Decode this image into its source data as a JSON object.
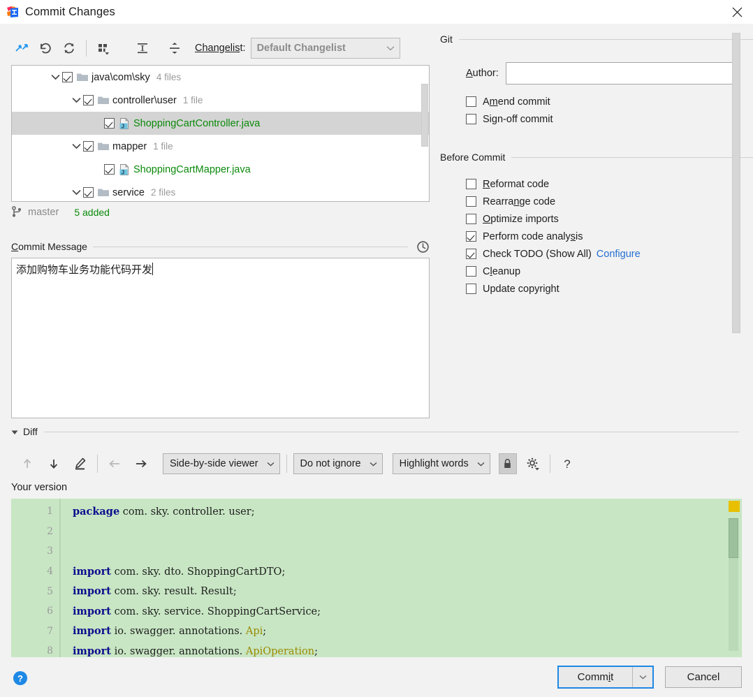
{
  "window": {
    "title": "Commit Changes",
    "app_icon": "intellij-idea-icon",
    "close_icon": "close-icon"
  },
  "toolbar": {
    "buttons": [
      {
        "name": "show-diff-icon",
        "glyph": "arrows-in"
      },
      {
        "name": "rollback-icon",
        "glyph": "undo"
      },
      {
        "name": "refresh-icon",
        "glyph": "refresh"
      },
      {
        "name": "group-by-icon",
        "glyph": "grid-dropdown"
      },
      {
        "name": "expand-all-icon",
        "glyph": "expand"
      },
      {
        "name": "collapse-all-icon",
        "glyph": "collapse"
      }
    ],
    "changelist_label": "Changelist:",
    "changelist_value": "Default Changelist",
    "changelist_enabled": false
  },
  "tree": {
    "rows": [
      {
        "indent": 0,
        "twisty": "chevron-down-icon",
        "checked": true,
        "icon": "folder-icon",
        "name": "java\\com\\sky",
        "count": "4 files",
        "kind": "dir",
        "selected": false
      },
      {
        "indent": 1,
        "twisty": "chevron-down-icon",
        "checked": true,
        "icon": "folder-icon",
        "name": "controller\\user",
        "count": "1 file",
        "kind": "dir",
        "selected": false
      },
      {
        "indent": 2,
        "twisty": "",
        "checked": true,
        "icon": "java-file-icon",
        "name": "ShoppingCartController.java",
        "count": "",
        "kind": "file",
        "selected": true
      },
      {
        "indent": 1,
        "twisty": "chevron-down-icon",
        "checked": true,
        "icon": "folder-icon",
        "name": "mapper",
        "count": "1 file",
        "kind": "dir",
        "selected": false
      },
      {
        "indent": 2,
        "twisty": "",
        "checked": true,
        "icon": "java-file-icon",
        "name": "ShoppingCartMapper.java",
        "count": "",
        "kind": "file",
        "selected": false
      },
      {
        "indent": 1,
        "twisty": "chevron-down-icon",
        "checked": true,
        "icon": "folder-icon",
        "name": "service",
        "count": "2 files",
        "kind": "dir",
        "selected": false
      }
    ]
  },
  "status": {
    "branch_icon": "git-branch-icon",
    "branch": "master",
    "added": "5 added",
    "added_color": "#0a8a0a"
  },
  "commit_message": {
    "label_prefix": "C",
    "label_rest": "ommit Message",
    "history_icon": "clock-icon",
    "value": "添加购物车业务功能代码开发"
  },
  "git_section": {
    "title": "Git",
    "author_label_prefix": "A",
    "author_label_rest": "uthor:",
    "author_value": "",
    "options": [
      {
        "name": "amend-commit",
        "prefix": "A",
        "u": "m",
        "rest": "end commit",
        "checked": false
      },
      {
        "name": "sign-off-commit",
        "prefix": "Si",
        "u": "g",
        "rest": "n-off commit",
        "checked": false
      }
    ]
  },
  "before_commit": {
    "title": "Before Commit",
    "options": [
      {
        "name": "reformat-code",
        "prefix": "",
        "u": "R",
        "rest": "eformat code",
        "checked": false,
        "link": ""
      },
      {
        "name": "rearrange-code",
        "prefix": "Rearra",
        "u": "n",
        "rest": "ge code",
        "checked": false,
        "link": ""
      },
      {
        "name": "optimize-imports",
        "prefix": "",
        "u": "O",
        "rest": "ptimize imports",
        "checked": false,
        "link": ""
      },
      {
        "name": "perform-code-analysis",
        "prefix": "Perform code analy",
        "u": "s",
        "rest": "is",
        "checked": true,
        "link": ""
      },
      {
        "name": "check-todo",
        "prefix": "Check TODO (Show All)",
        "u": "",
        "rest": "",
        "checked": true,
        "link": "Configure"
      },
      {
        "name": "cleanup",
        "prefix": "C",
        "u": "l",
        "rest": "eanup",
        "checked": false,
        "link": ""
      },
      {
        "name": "update-copyright",
        "prefix": "Update copyright",
        "u": "",
        "rest": "",
        "checked": false,
        "link": ""
      }
    ]
  },
  "diff": {
    "section_title": "Diff",
    "collapse_icon": "triangle-down-icon",
    "buttons": [
      {
        "name": "previous-difference-icon",
        "glyph": "arrow-up",
        "disabled": true
      },
      {
        "name": "next-difference-icon",
        "glyph": "arrow-down",
        "disabled": false
      },
      {
        "name": "edit-source-icon",
        "glyph": "pencil",
        "disabled": false
      },
      {
        "name": "accept-left-icon",
        "glyph": "arrow-left",
        "disabled": true
      },
      {
        "name": "accept-right-icon",
        "glyph": "arrow-right",
        "disabled": false
      }
    ],
    "viewer_mode": "Side-by-side viewer",
    "whitespace_mode": "Do not ignore",
    "highlight_mode": "Highlight words",
    "lock_icon": "lock-icon",
    "settings_icon": "gear-icon",
    "help_icon": "question-mark-icon",
    "pane_label": "Your version"
  },
  "code": {
    "marker_color": "#e8c000",
    "background": "#c8e6c4",
    "lines": [
      {
        "n": "1",
        "segments": [
          {
            "t": "package",
            "c": "kw"
          },
          {
            "t": " com. sky. controller. user;",
            "c": ""
          }
        ]
      },
      {
        "n": "2",
        "segments": []
      },
      {
        "n": "3",
        "segments": []
      },
      {
        "n": "4",
        "segments": [
          {
            "t": "import",
            "c": "kw"
          },
          {
            "t": " com. sky. dto. ShoppingCartDTO;",
            "c": ""
          }
        ]
      },
      {
        "n": "5",
        "segments": [
          {
            "t": "import",
            "c": "kw"
          },
          {
            "t": " com. sky. result. Result;",
            "c": ""
          }
        ]
      },
      {
        "n": "6",
        "segments": [
          {
            "t": "import",
            "c": "kw"
          },
          {
            "t": " com. sky. service. ShoppingCartService;",
            "c": ""
          }
        ]
      },
      {
        "n": "7",
        "segments": [
          {
            "t": "import",
            "c": "kw"
          },
          {
            "t": " io. swagger. annotations. ",
            "c": ""
          },
          {
            "t": "Api",
            "c": "ann"
          },
          {
            "t": ";",
            "c": ""
          }
        ]
      },
      {
        "n": "8",
        "segments": [
          {
            "t": "import",
            "c": "kw"
          },
          {
            "t": " io. swagger. annotations. ",
            "c": ""
          },
          {
            "t": "ApiOperation",
            "c": "ann"
          },
          {
            "t": ";",
            "c": ""
          }
        ]
      }
    ]
  },
  "footer": {
    "help_icon": "help-circle-icon",
    "commit_prefix": "Comm",
    "commit_u": "i",
    "commit_rest": "t",
    "commit_dropdown_icon": "chevron-down-icon",
    "cancel_label": "Cancel",
    "accent_color": "#1e88e5"
  }
}
